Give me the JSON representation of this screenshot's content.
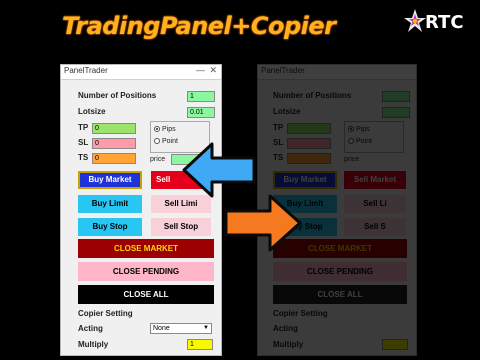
{
  "banner": {
    "title": "TradingPanel+Copier",
    "logo_text": "RTC"
  },
  "panel": {
    "title": "PanelTrader",
    "minimize_glyph": "—",
    "close_glyph": "✕",
    "num_positions_label": "Number of Positions",
    "num_positions_value": "1",
    "lotsize_label": "Lotsize",
    "lotsize_value": "0.01",
    "tp_label": "TP",
    "tp_value": "0",
    "sl_label": "SL",
    "sl_value": "0",
    "ts_label": "TS",
    "ts_value": "0",
    "mode_options": [
      "Pips",
      "Point"
    ],
    "price_label": "price",
    "buttons": {
      "buy_market": "Buy Market",
      "sell_market": "Sell",
      "buy_limit": "Buy Limit",
      "sell_limit": "Sell Limi",
      "buy_stop": "Buy Stop",
      "sell_stop": "Sell Stop",
      "close_market": "CLOSE MARKET",
      "close_pending": "CLOSE PENDING",
      "close_all": "CLOSE ALL"
    },
    "copier_setting_label": "Copier Setting",
    "acting_label": "Acting",
    "acting_value": "None",
    "multiply_label": "Multiply",
    "multiply_value": "1"
  },
  "ghost_panel": {
    "title": "PanelTrader",
    "num_positions_label": "Number of Positions",
    "lotsize_label": "Lotsize",
    "tp_label": "TP",
    "sl_label": "SL",
    "ts_label": "TS",
    "mode_options": [
      "Pips",
      "Point"
    ],
    "price_label": "price",
    "buttons": {
      "buy_market": "Buy Market",
      "sell_market": "Sell Market",
      "buy_limit": "Buy Limit",
      "sell_limit": "Sell Li",
      "buy_stop": "Buy Stop",
      "sell_stop": "Sell S",
      "close_market": "CLOSE MARKET",
      "close_pending": "CLOSE PENDING",
      "close_all": "CLOSE ALL"
    },
    "copier_setting_label": "Copier Setting",
    "acting_label": "Acting",
    "multiply_label": "Multiply"
  },
  "icons": {
    "left_arrow": "arrow-left-icon",
    "right_arrow": "arrow-right-icon"
  },
  "colors": {
    "arrow_left": "#3fa9f5",
    "arrow_right": "#f57a1f",
    "banner_text": "#ffb21e",
    "buy_market": "#1f33d8",
    "sell_market": "#e4001a",
    "close_market": "#9d0000"
  }
}
